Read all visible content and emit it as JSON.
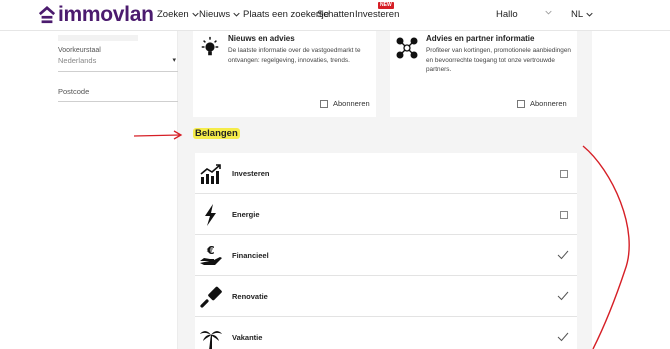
{
  "nav": {
    "logo_text": "immovlan",
    "items": [
      {
        "label": "Zoeken",
        "has_chevron": true
      },
      {
        "label": "Nieuws",
        "has_chevron": true
      },
      {
        "label": "Plaats een zoekertje",
        "has_chevron": false
      },
      {
        "label": "Schatten",
        "has_chevron": false
      },
      {
        "label": "Investeren",
        "has_chevron": false
      }
    ],
    "new_badge": "NEW",
    "greeting": "Hallo",
    "language": "NL"
  },
  "sidebar": {
    "country_label": "Voorkeurstaal",
    "country_value": "Nederlands",
    "postcode_placeholder": "Postcode"
  },
  "cards": {
    "news": {
      "title": "Nieuws en advies",
      "description": "De laatste informatie over de vastgoedmarkt te ontvangen: regelgeving, innovaties, trends.",
      "subscribe_label": "Abonneren"
    },
    "partners": {
      "title": "Advies en partner informatie",
      "description": "Profiteer van kortingen, promotionele aanbiedingen en bevoorrechte toegang tot onze vertrouwde partners.",
      "subscribe_label": "Abonneren"
    }
  },
  "interests": {
    "title": "Belangen",
    "items": [
      {
        "label": "Investeren",
        "icon": "chart-up-icon",
        "checked": false
      },
      {
        "label": "Energie",
        "icon": "lightning-icon",
        "checked": false
      },
      {
        "label": "Financieel",
        "icon": "euro-hand-icon",
        "checked": true
      },
      {
        "label": "Renovatie",
        "icon": "paint-roller-icon",
        "checked": true
      },
      {
        "label": "Vakantie",
        "icon": "palm-tree-icon",
        "checked": true
      }
    ]
  },
  "colors": {
    "brand": "#4b1b6e",
    "highlight": "#f5ec4a",
    "annotation": "#d61f26",
    "new_badge": "#d61f26"
  }
}
